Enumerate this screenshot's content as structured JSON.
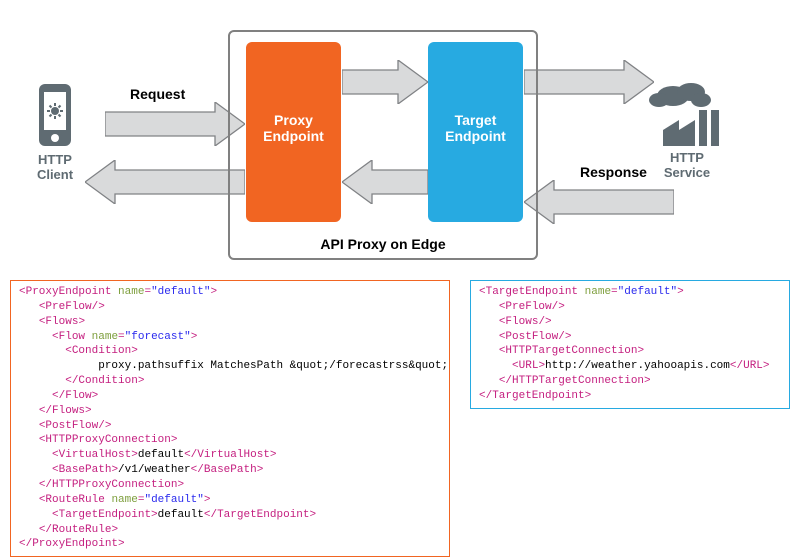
{
  "diagram": {
    "client_label_l1": "HTTP",
    "client_label_l2": "Client",
    "service_label_l1": "HTTP",
    "service_label_l2": "Service",
    "request_label": "Request",
    "response_label": "Response",
    "proxy_endpoint_l1": "Proxy",
    "proxy_endpoint_l2": "Endpoint",
    "target_endpoint_l1": "Target",
    "target_endpoint_l2": "Endpoint",
    "container_label": "API Proxy on Edge"
  },
  "colors": {
    "proxy_orange": "#f16522",
    "target_blue": "#27aae1",
    "icon_gray": "#5f6b72",
    "arrow_fill": "#d9dadb",
    "arrow_stroke": "#808285"
  },
  "proxy_xml": {
    "root_tag": "ProxyEndpoint",
    "root_attr_name": "name",
    "root_attr_val": "default",
    "preflow": "PreFlow",
    "flows": "Flows",
    "flow_tag": "Flow",
    "flow_attr_name": "name",
    "flow_attr_val": "forecast",
    "condition_tag": "Condition",
    "condition_text": "proxy.pathsuffix MatchesPath &quot;/forecastrss&quot;",
    "postflow": "PostFlow",
    "httpconn": "HTTPProxyConnection",
    "vhost_tag": "VirtualHost",
    "vhost_val": "default",
    "basepath_tag": "BasePath",
    "basepath_val": "/v1/weather",
    "routerule_tag": "RouteRule",
    "routerule_attr_name": "name",
    "routerule_attr_val": "default",
    "targetep_tag": "TargetEndpoint",
    "targetep_val": "default"
  },
  "target_xml": {
    "root_tag": "TargetEndpoint",
    "root_attr_name": "name",
    "root_attr_val": "default",
    "preflow": "PreFlow",
    "flows": "Flows",
    "postflow": "PostFlow",
    "httpconn": "HTTPTargetConnection",
    "url_tag": "URL",
    "url_val": "http://weather.yahooapis.com"
  }
}
